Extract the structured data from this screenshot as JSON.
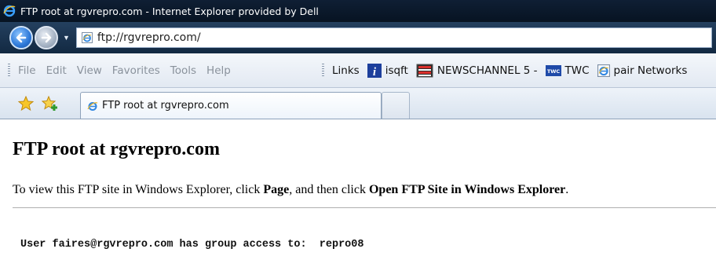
{
  "window": {
    "title": "FTP root at rgvrepro.com - Internet Explorer provided by Dell"
  },
  "nav": {
    "address": "ftp://rgvrepro.com/"
  },
  "menu": {
    "items": [
      "File",
      "Edit",
      "View",
      "Favorites",
      "Tools",
      "Help"
    ]
  },
  "links_bar": {
    "label": "Links",
    "items": [
      {
        "label": "isqft",
        "icon": "info-icon"
      },
      {
        "label": "NEWSCHANNEL 5 -",
        "icon": "tv-icon"
      },
      {
        "label": "TWC",
        "icon": "twc-icon"
      },
      {
        "label": "pair Networks",
        "icon": "ie-page-icon"
      }
    ],
    "twc_icon_text": "TWC"
  },
  "tabs": {
    "active_label": "FTP root at rgvrepro.com"
  },
  "page": {
    "heading": "FTP root at rgvrepro.com",
    "instructions": {
      "prefix": "To view this FTP site in Windows Explorer, click ",
      "bold1": "Page",
      "middle": ", and then click ",
      "bold2": "Open FTP Site in Windows Explorer",
      "suffix": "."
    },
    "access_line": "User faires@rgvrepro.com has group access to:  repro08"
  },
  "colors": {
    "title_bar": "#0f1f34",
    "nav_bar": "#1c3553",
    "back_button": "#2c78d8",
    "menu_bar": "#eaf0f7",
    "menu_text": "#8a929c"
  }
}
